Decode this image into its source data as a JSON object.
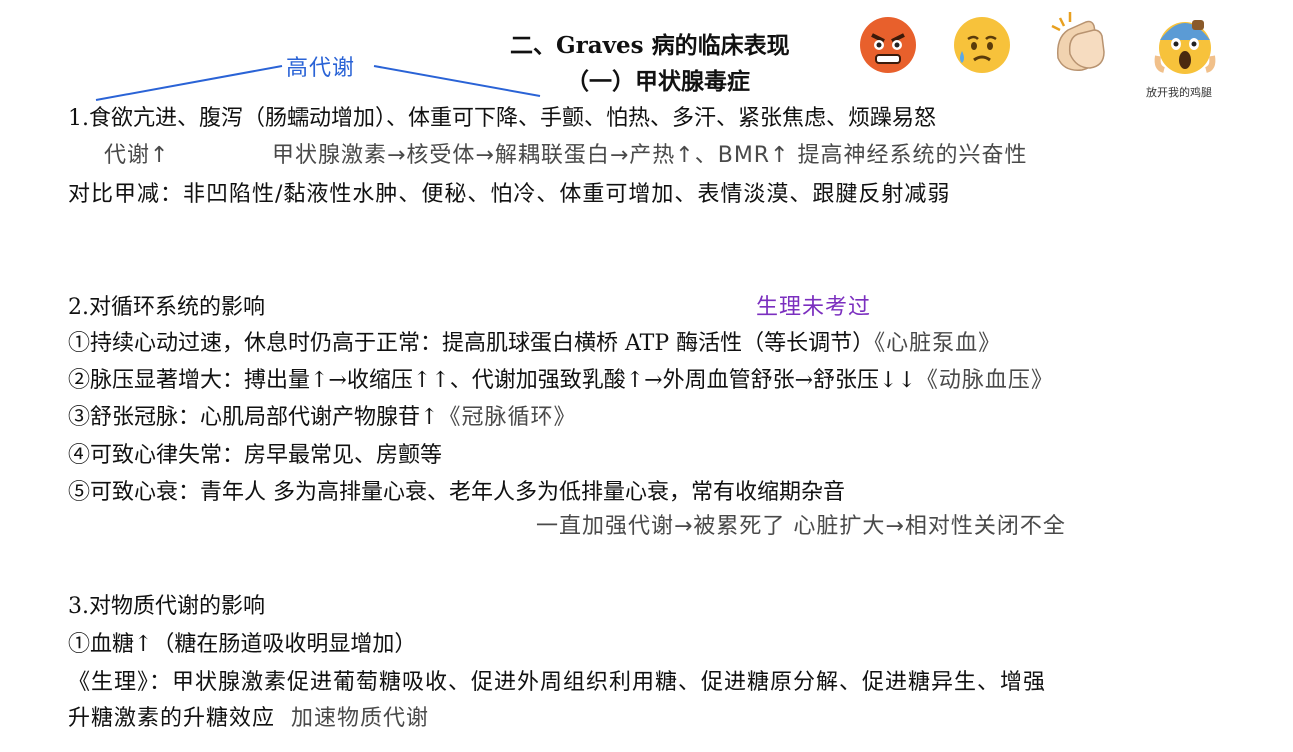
{
  "title": {
    "main": "二、Graves 病的临床表现",
    "sub": "（一）甲状腺毒症"
  },
  "annotations": {
    "high_metabolism": "高代谢",
    "physiology_not_tested": "生理未考过"
  },
  "stickers": {
    "caption": "放开我的鸡腿",
    "icons": [
      "angry-face-icon",
      "sad-sweat-face-icon",
      "clapping-hands-icon",
      "scream-face-icon"
    ]
  },
  "section1": {
    "line1": "1.食欲亢进、腹泻（肠蠕动增加）、体重可下降、手颤、怕热、多汗、紧张焦虑、烦躁易怒",
    "note_left": "代谢↑",
    "note_right": "甲状腺激素→核受体→解耦联蛋白→产热↑、BMR↑ 提高神经系统的兴奋性",
    "contrast": "对比甲减：非凹陷性/黏液性水肿、便秘、怕冷、体重可增加、表情淡漠、跟腱反射减弱"
  },
  "section2": {
    "heading": "2.对循环系统的影响",
    "item1": "①持续心动过速，休息时仍高于正常：提高肌球蛋白横桥 ATP 酶活性（等长调节）",
    "item1_note": "《心脏泵血》",
    "item2": "②脉压显著增大：搏出量↑→收缩压↑↑、代谢加强致乳酸↑→外周血管舒张→舒张压↓↓",
    "item2_note": "《动脉血压》",
    "item3": "③舒张冠脉：心肌局部代谢产物腺苷↑",
    "item3_note": "《冠脉循环》",
    "item4": "④可致心律失常：房早最常见、房颤等",
    "item5": "⑤可致心衰：青年人 多为高排量心衰、老年人多为低排量心衰，常有收缩期杂音",
    "item5_note": "一直加强代谢→被累死了  心脏扩大→相对性关闭不全"
  },
  "section3": {
    "heading": "3.对物质代谢的影响",
    "item1": "①血糖↑（糖在肠道吸收明显增加）",
    "physiology_line1": "《生理》：甲状腺激素促进葡萄糖吸收、促进外周组织利用糖、促进糖原分解、促进糖异生、增强",
    "physiology_line2": "升糖激素的升糖效应",
    "physiology_note": "加速物质代谢"
  },
  "colors": {
    "annotation_blue": "#2a63d6",
    "annotation_purple": "#7b2fbf"
  }
}
